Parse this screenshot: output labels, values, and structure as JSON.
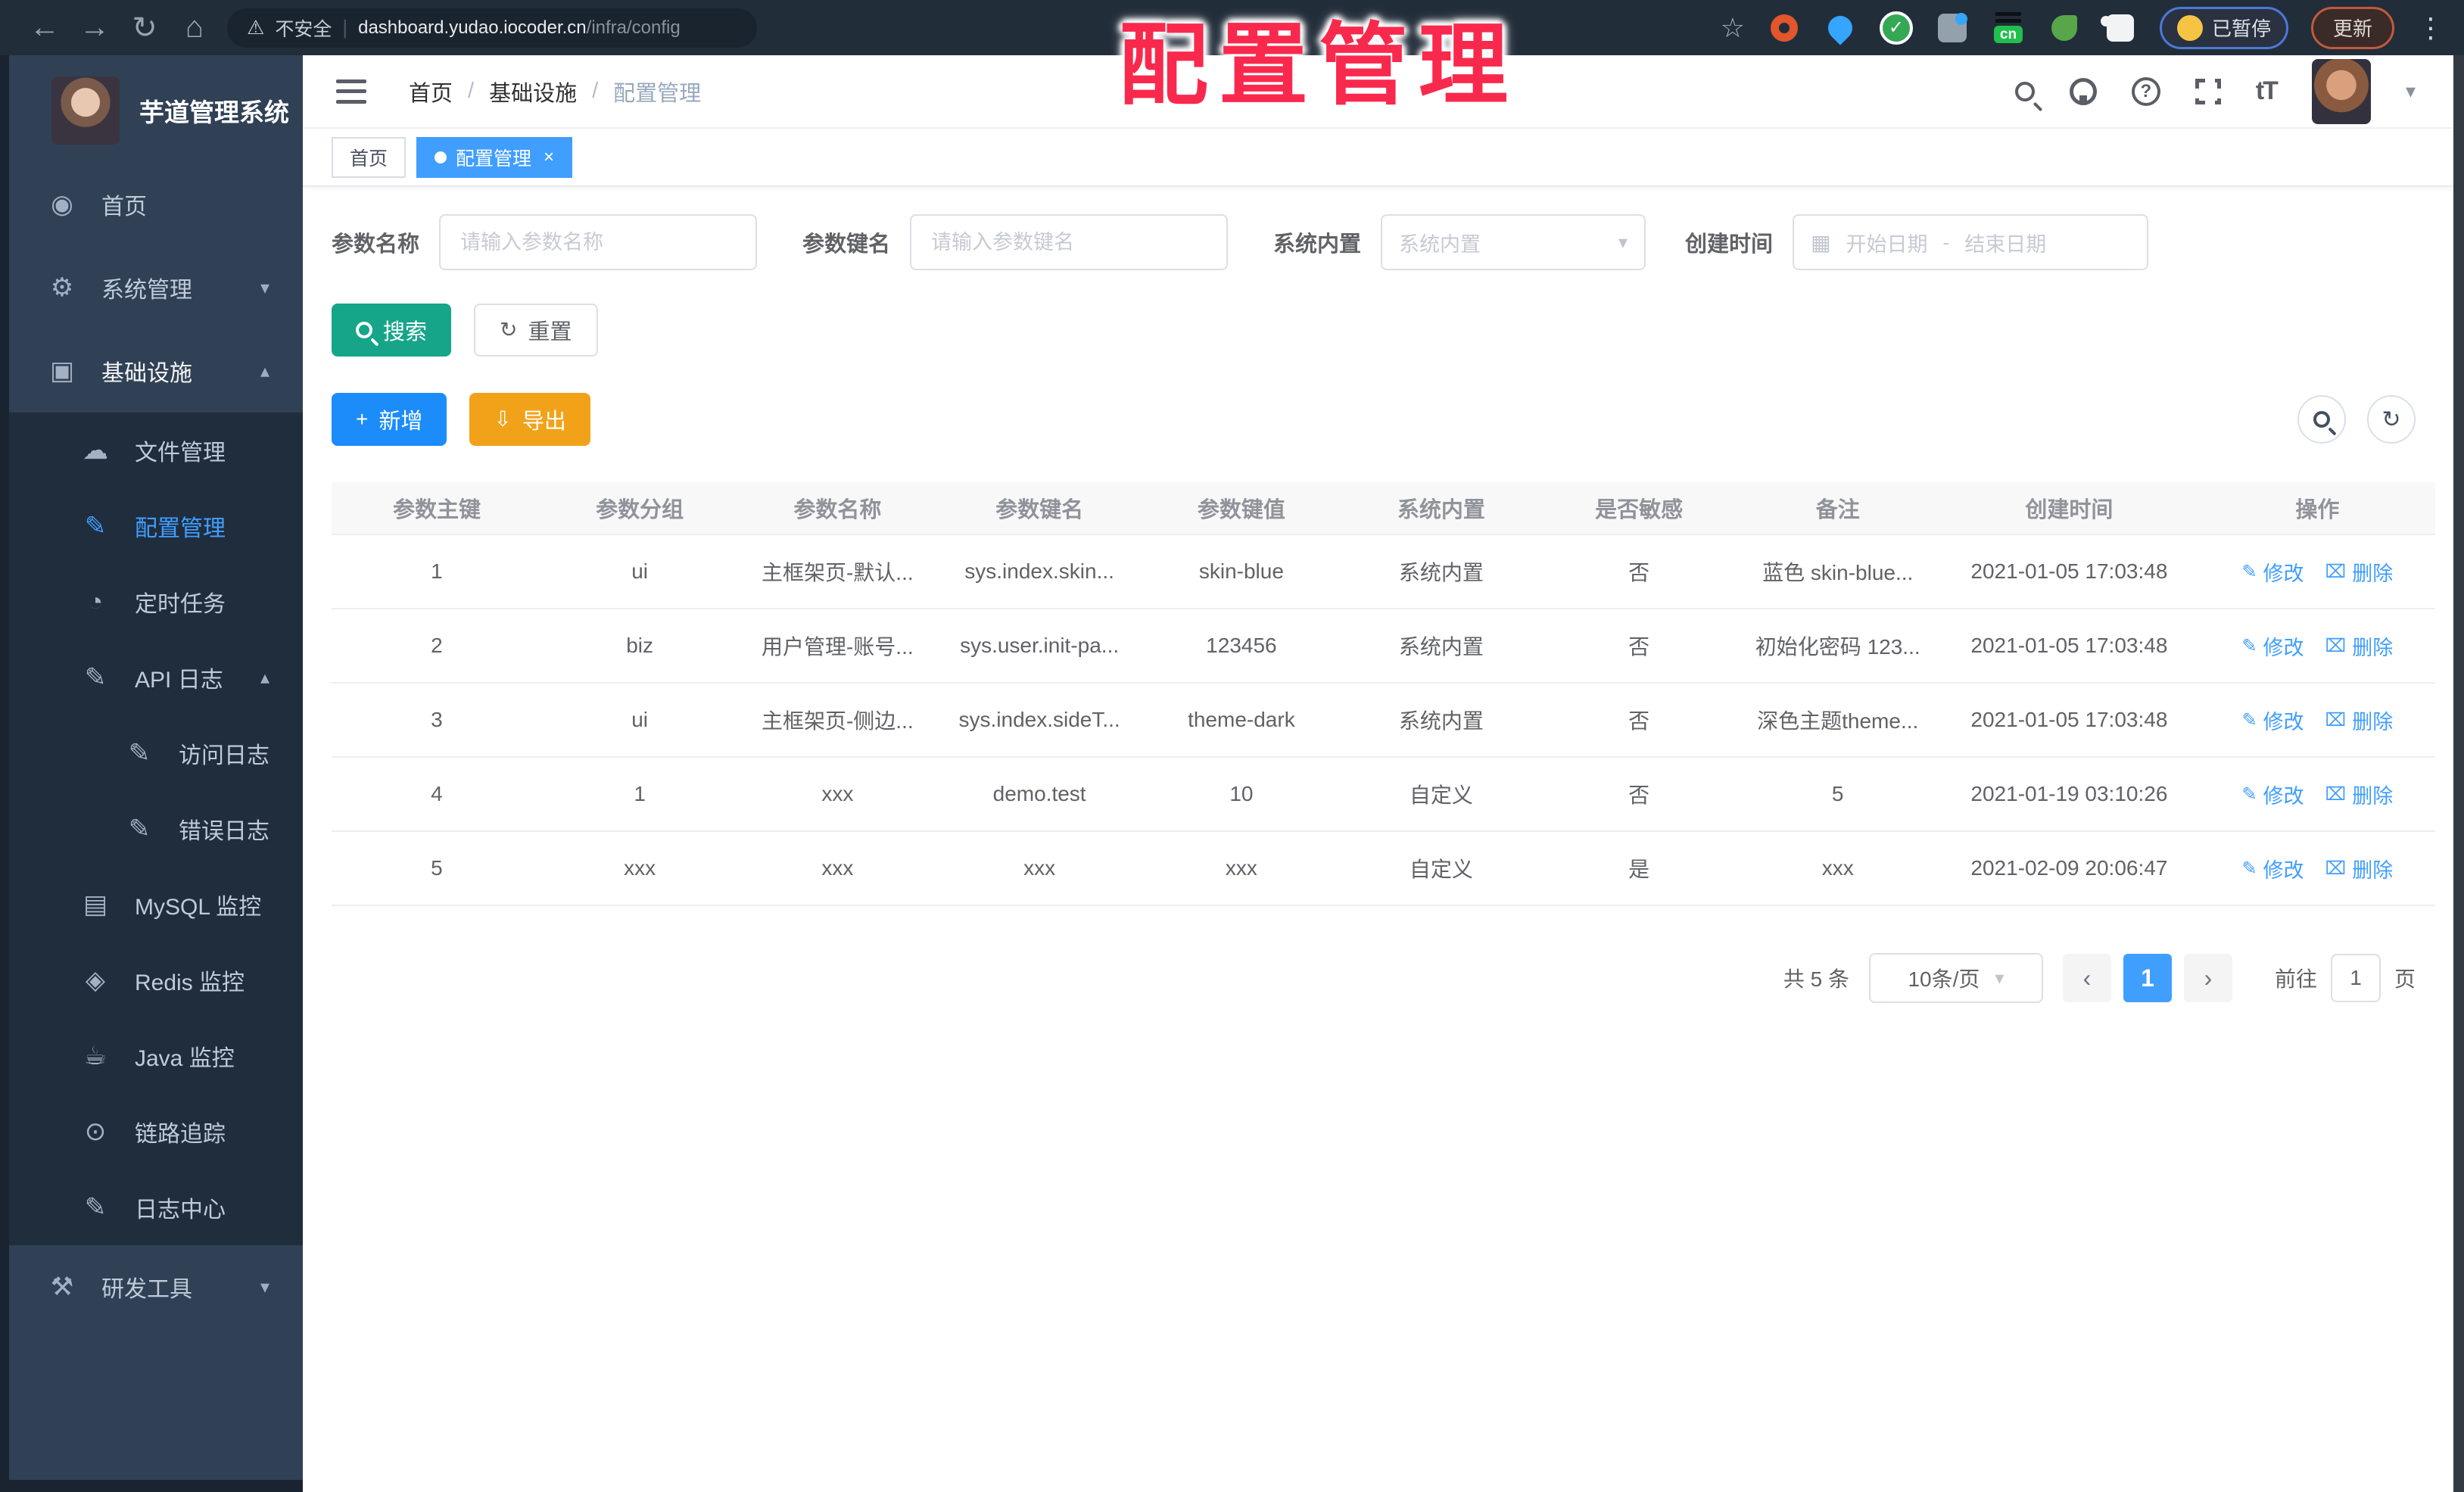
{
  "overlay_title": "配置管理",
  "colors": {
    "accent": "#409eff",
    "search_button": "#16a589",
    "add_button": "#1b8cfa",
    "export_button": "#f2a219",
    "title_red": "#f9294d",
    "sidebar_bg": "#304156",
    "submenu_bg": "#1f2d3d"
  },
  "browser": {
    "back_icon": "←",
    "forward_icon": "→",
    "reload_icon": "↻",
    "home_icon": "⌂",
    "warning_icon": "⚠",
    "security_label": "不安全",
    "url_host": "dashboard.yudao.iocoder.cn",
    "url_path": "/infra/config",
    "bookmark_icon": "☆",
    "cn_badge": "cn",
    "paused_label": "已暂停",
    "update_label": "更新",
    "menu_icon": "⋮"
  },
  "sidebar": {
    "app_title": "芋道管理系统",
    "items": [
      {
        "name": "home",
        "label": "首页",
        "icon": "dashboard-icon",
        "glyph": "◉",
        "level": 0,
        "arrow": "",
        "active": false,
        "hl": false
      },
      {
        "name": "system",
        "label": "系统管理",
        "icon": "gear-icon",
        "glyph": "⚙",
        "level": 0,
        "arrow": "▾",
        "active": false,
        "hl": false
      },
      {
        "name": "infra",
        "label": "基础设施",
        "icon": "monitor-icon",
        "glyph": "▣",
        "level": 0,
        "arrow": "▴",
        "active": false,
        "hl": true
      },
      {
        "name": "file-manage",
        "label": "文件管理",
        "icon": "cloud-icon",
        "glyph": "☁",
        "level": 1,
        "arrow": "",
        "active": false,
        "hl": false
      },
      {
        "name": "config-manage",
        "label": "配置管理",
        "icon": "edit-icon",
        "glyph": "✎",
        "level": 1,
        "arrow": "",
        "active": true,
        "hl": false
      },
      {
        "name": "scheduled-jobs",
        "label": "定时任务",
        "icon": "clock-icon",
        "glyph": "◔",
        "level": 1,
        "arrow": "",
        "active": false,
        "hl": false
      },
      {
        "name": "api-log",
        "label": "API 日志",
        "icon": "log-icon",
        "glyph": "✎",
        "level": 1,
        "arrow": "▴",
        "active": false,
        "hl": false
      },
      {
        "name": "access-log",
        "label": "访问日志",
        "icon": "log-icon",
        "glyph": "✎",
        "level": 2,
        "arrow": "",
        "active": false,
        "hl": false
      },
      {
        "name": "error-log",
        "label": "错误日志",
        "icon": "log-icon",
        "glyph": "✎",
        "level": 2,
        "arrow": "",
        "active": false,
        "hl": false
      },
      {
        "name": "mysql-monitor",
        "label": "MySQL 监控",
        "icon": "database-icon",
        "glyph": "▤",
        "level": 1,
        "arrow": "",
        "active": false,
        "hl": false
      },
      {
        "name": "redis-monitor",
        "label": "Redis 监控",
        "icon": "redis-icon",
        "glyph": "◈",
        "level": 1,
        "arrow": "",
        "active": false,
        "hl": false
      },
      {
        "name": "java-monitor",
        "label": "Java 监控",
        "icon": "java-icon",
        "glyph": "☕",
        "level": 1,
        "arrow": "",
        "active": false,
        "hl": false
      },
      {
        "name": "trace",
        "label": "链路追踪",
        "icon": "eye-icon",
        "glyph": "⊙",
        "level": 1,
        "arrow": "",
        "active": false,
        "hl": false
      },
      {
        "name": "log-center",
        "label": "日志中心",
        "icon": "log-icon",
        "glyph": "✎",
        "level": 1,
        "arrow": "",
        "active": false,
        "hl": false
      },
      {
        "name": "dev-tools",
        "label": "研发工具",
        "icon": "toolbox-icon",
        "glyph": "⚒",
        "level": 0,
        "arrow": "▾",
        "active": false,
        "hl": false
      }
    ]
  },
  "header": {
    "breadcrumb": [
      {
        "label": "首页"
      },
      {
        "label": "基础设施"
      },
      {
        "label": "配置管理"
      }
    ],
    "separator": "/",
    "font_size_label": "tT",
    "caret_icon": "▾"
  },
  "tabs": [
    {
      "label": "首页",
      "active": false
    },
    {
      "label": "配置管理",
      "active": true,
      "close_icon": "×"
    }
  ],
  "filters": {
    "name_label": "参数名称",
    "name_placeholder": "请输入参数名称",
    "key_label": "参数键名",
    "key_placeholder": "请输入参数键名",
    "builtin_label": "系统内置",
    "builtin_placeholder": "系统内置",
    "caret_icon": "▾",
    "date_label": "创建时间",
    "calendar_icon": "▦",
    "date_start_placeholder": "开始日期",
    "date_separator": "-",
    "date_end_placeholder": "结束日期"
  },
  "toolbar": {
    "search_label": "搜索",
    "reset_label": "重置",
    "reset_icon": "↻",
    "add_label": "新增",
    "add_icon": "+",
    "export_label": "导出",
    "export_icon": "⇩",
    "refresh_icon": "↻"
  },
  "table": {
    "columns": [
      "参数主键",
      "参数分组",
      "参数名称",
      "参数键名",
      "参数键值",
      "系统内置",
      "是否敏感",
      "备注",
      "创建时间",
      "操作"
    ],
    "rows": [
      [
        "1",
        "ui",
        "主框架页-默认...",
        "sys.index.skin...",
        "skin-blue",
        "系统内置",
        "否",
        "蓝色 skin-blue...",
        "2021-01-05 17:03:48"
      ],
      [
        "2",
        "biz",
        "用户管理-账号...",
        "sys.user.init-pa...",
        "123456",
        "系统内置",
        "否",
        "初始化密码 123...",
        "2021-01-05 17:03:48"
      ],
      [
        "3",
        "ui",
        "主框架页-侧边...",
        "sys.index.sideT...",
        "theme-dark",
        "系统内置",
        "否",
        "深色主题theme...",
        "2021-01-05 17:03:48"
      ],
      [
        "4",
        "1",
        "xxx",
        "demo.test",
        "10",
        "自定义",
        "否",
        "5",
        "2021-01-19 03:10:26"
      ],
      [
        "5",
        "xxx",
        "xxx",
        "xxx",
        "xxx",
        "自定义",
        "是",
        "xxx",
        "2021-02-09 20:06:47"
      ]
    ],
    "edit_icon": "✎",
    "edit_label": "修改",
    "delete_icon": "⌧",
    "delete_label": "删除"
  },
  "pagination": {
    "total_text": "共 5 条",
    "page_size": "10条/页",
    "caret_icon": "▾",
    "prev_icon": "‹",
    "current_page": "1",
    "next_icon": "›",
    "goto_label": "前往",
    "goto_value": "1",
    "page_unit": "页"
  }
}
